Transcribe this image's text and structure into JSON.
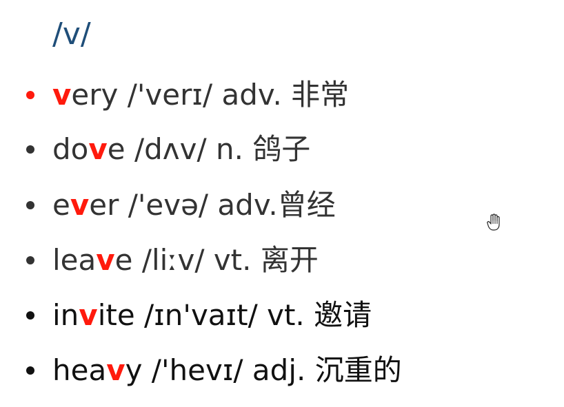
{
  "heading": "/v/",
  "colors": {
    "heading": "#1f4e79",
    "highlight": "#ff1a0d",
    "gray_text": "#333333",
    "black_text": "#111111"
  },
  "items": [
    {
      "pre": "",
      "hl": "v",
      "post": "ery",
      "rest": " /'verɪ/ adv. 非常",
      "bullet_color": "#ff1a0d",
      "text_color": "#333333"
    },
    {
      "pre": "do",
      "hl": "v",
      "post": "e",
      "rest": " /dʌv/ n. 鸽子",
      "bullet_color": "#333333",
      "text_color": "#333333"
    },
    {
      "pre": "e",
      "hl": "v",
      "post": "er",
      "rest": " /'evə/ adv.曾经",
      "bullet_color": "#333333",
      "text_color": "#333333"
    },
    {
      "pre": "lea",
      "hl": "v",
      "post": "e",
      "rest": " /liːv/ vt. 离开",
      "bullet_color": "#333333",
      "text_color": "#333333"
    },
    {
      "pre": "in",
      "hl": "v",
      "post": "ite",
      "rest": " /ɪn'vaɪt/ vt. 邀请",
      "bullet_color": "#111111",
      "text_color": "#111111"
    },
    {
      "pre": "hea",
      "hl": "v",
      "post": "y",
      "rest": " /'hevɪ/ adj. 沉重的",
      "bullet_color": "#111111",
      "text_color": "#111111"
    }
  ]
}
